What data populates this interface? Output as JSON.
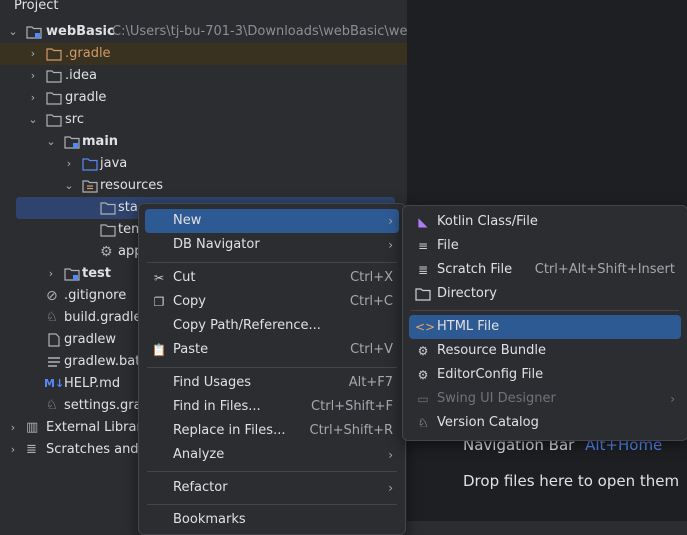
{
  "project": {
    "title": "Project",
    "root_name": "webBasic",
    "root_path": "C:\\Users\\tj-bu-701-3\\Downloads\\webBasic\\web",
    "tree": [
      {
        "label": "webBasic"
      },
      {
        "label": ".gradle"
      },
      {
        "label": ".idea"
      },
      {
        "label": "gradle"
      },
      {
        "label": "src"
      },
      {
        "label": "main"
      },
      {
        "label": "java"
      },
      {
        "label": "resources"
      },
      {
        "label": "sta"
      },
      {
        "label": "tem"
      },
      {
        "label": "app"
      },
      {
        "label": "test"
      },
      {
        "label": ".gitignore"
      },
      {
        "label": "build.gradle"
      },
      {
        "label": "gradlew"
      },
      {
        "label": "gradlew.bat"
      },
      {
        "label": "HELP.md"
      },
      {
        "label": "settings.gra"
      },
      {
        "label": "External Librari"
      },
      {
        "label": "Scratches and"
      }
    ]
  },
  "editor": {
    "nav_bar_label": "Navigation Bar",
    "nav_bar_key": "Alt+Home",
    "drop_hint": "Drop files here to open them"
  },
  "context_menu": {
    "new": "New",
    "db_navigator": "DB Navigator",
    "cut": "Cut",
    "cut_shortcut": "Ctrl+X",
    "copy": "Copy",
    "copy_shortcut": "Ctrl+C",
    "copy_path": "Copy Path/Reference...",
    "paste": "Paste",
    "paste_shortcut": "Ctrl+V",
    "find_usages": "Find Usages",
    "find_usages_shortcut": "Alt+F7",
    "find_in_files": "Find in Files...",
    "find_in_files_shortcut": "Ctrl+Shift+F",
    "replace_in_files": "Replace in Files...",
    "replace_in_files_shortcut": "Ctrl+Shift+R",
    "analyze": "Analyze",
    "refactor": "Refactor",
    "bookmarks": "Bookmarks"
  },
  "submenu": {
    "kotlin": "Kotlin Class/File",
    "file": "File",
    "scratch": "Scratch File",
    "scratch_shortcut": "Ctrl+Alt+Shift+Insert",
    "directory": "Directory",
    "html": "HTML File",
    "resource_bundle": "Resource Bundle",
    "editorconfig": "EditorConfig File",
    "swing": "Swing UI Designer",
    "version_catalog": "Version Catalog"
  },
  "colors": {
    "selection": "#2e5a94",
    "tree_selection": "#2e436e",
    "link": "#548af7",
    "folder_orange": "#d19a66"
  }
}
